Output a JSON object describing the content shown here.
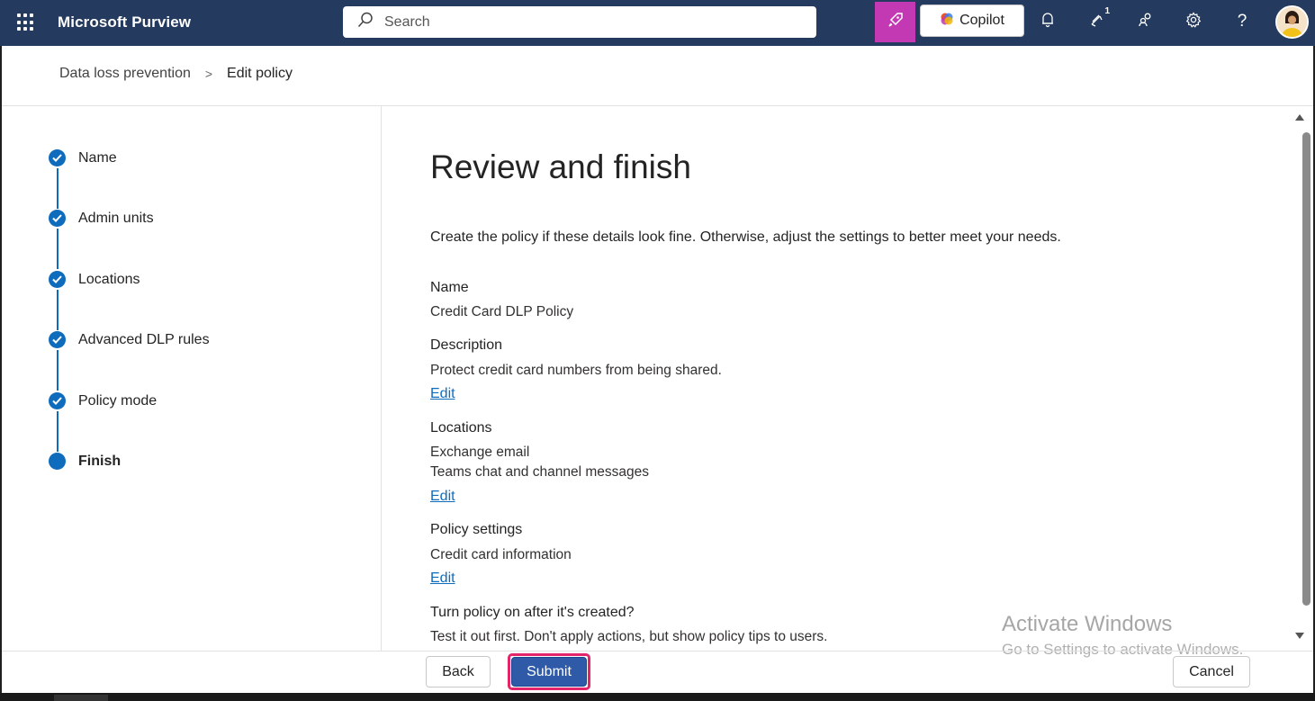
{
  "topbar": {
    "app_title": "Microsoft Purview",
    "search_placeholder": "Search",
    "copilot_label": "Copilot",
    "notification_count": "1",
    "help_label": "?"
  },
  "breadcrumb": {
    "parent": "Data loss prevention",
    "separator": ">",
    "current": "Edit policy"
  },
  "steps": [
    {
      "label": "Name",
      "status": "completed"
    },
    {
      "label": "Admin units",
      "status": "completed"
    },
    {
      "label": "Locations",
      "status": "completed"
    },
    {
      "label": "Advanced DLP rules",
      "status": "completed"
    },
    {
      "label": "Policy mode",
      "status": "completed"
    },
    {
      "label": "Finish",
      "status": "current"
    }
  ],
  "review": {
    "title": "Review and finish",
    "intro": "Create the policy if these details look fine. Otherwise, adjust the settings to better meet your needs.",
    "name_title": "Name",
    "name_value": "Credit Card DLP Policy",
    "description_title": "Description",
    "description_value": "Protect credit card numbers from being shared.",
    "edit_label": "Edit",
    "locations_title": "Locations",
    "locations_values": [
      "Exchange email",
      "Teams chat and channel messages"
    ],
    "policy_settings_title": "Policy settings",
    "policy_settings_value": "Credit card information",
    "turn_on_title": "Turn policy on after it's created?",
    "turn_on_value": "Test it out first. Don't apply actions, but show policy tips to users."
  },
  "footer": {
    "back_label": "Back",
    "submit_label": "Submit",
    "cancel_label": "Cancel"
  },
  "watermark": {
    "line1": "Activate Windows",
    "line2": "Go to Settings to activate Windows."
  },
  "colors": {
    "topbar_bg": "#243a5e",
    "accent": "#0f6cbd",
    "submit_bg": "#2f5aa8",
    "highlight": "#e3256b",
    "rocket_bg": "#c239b3"
  }
}
